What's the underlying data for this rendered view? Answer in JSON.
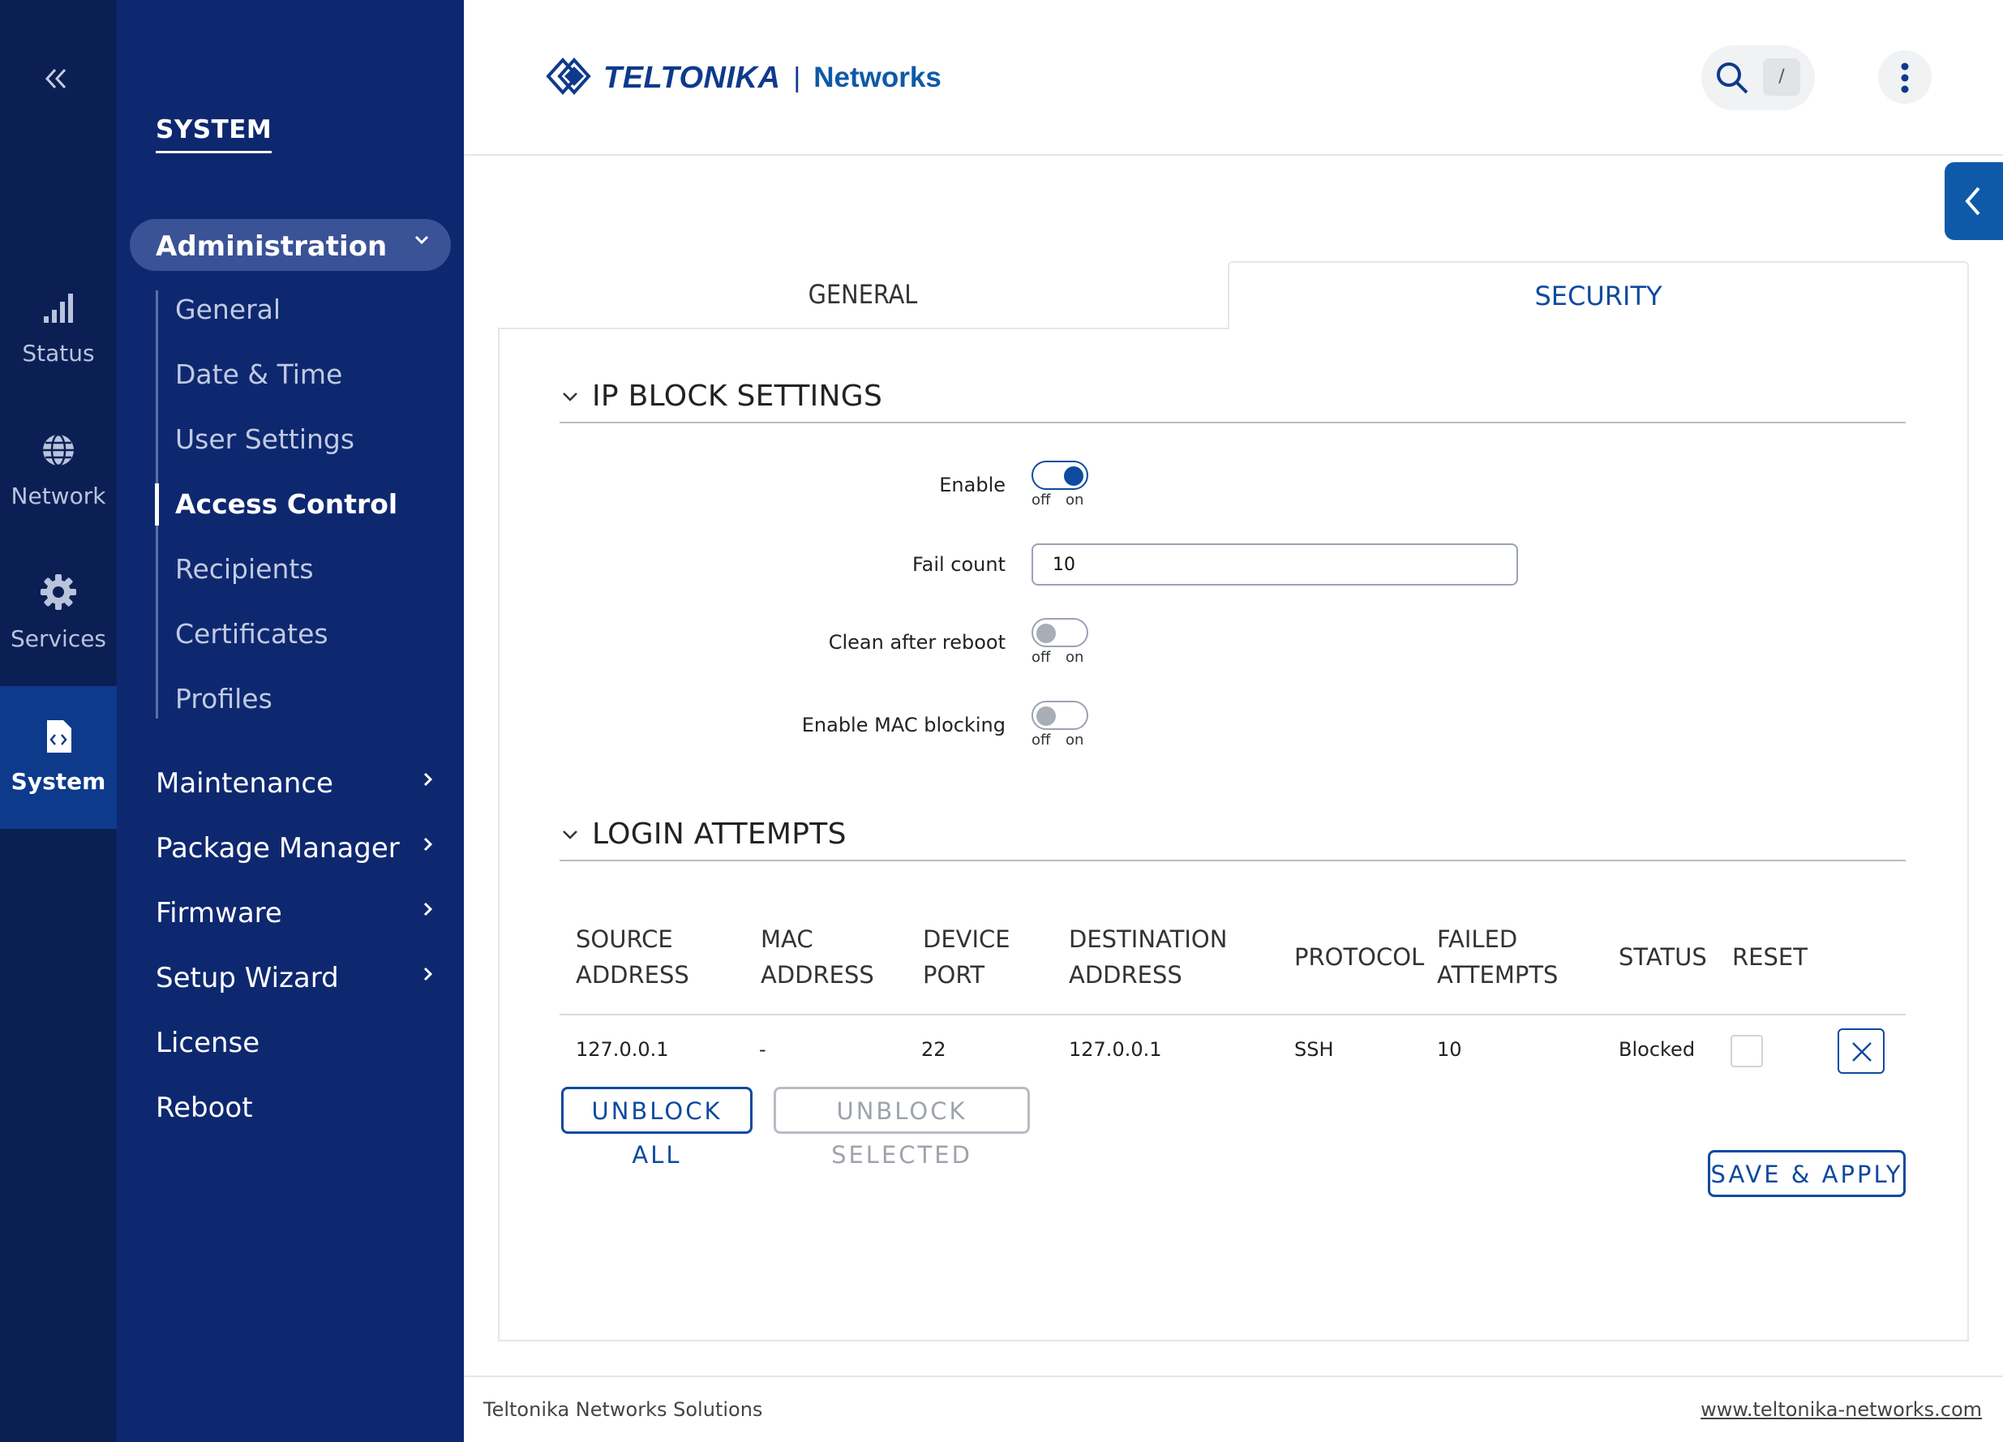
{
  "rail": {
    "collapse_icon": "double-chevron-left-icon",
    "items": [
      {
        "label": "Status",
        "icon": "signal-bars-icon"
      },
      {
        "label": "Network",
        "icon": "globe-icon"
      },
      {
        "label": "Services",
        "icon": "gear-icon"
      },
      {
        "label": "System",
        "icon": "code-file-icon",
        "active": true
      }
    ]
  },
  "sidebar": {
    "title": "SYSTEM",
    "admin": {
      "label": "Administration"
    },
    "sub_items": [
      {
        "label": "General"
      },
      {
        "label": "Date & Time"
      },
      {
        "label": "User Settings"
      },
      {
        "label": "Access Control",
        "active": true
      },
      {
        "label": "Recipients"
      },
      {
        "label": "Certificates"
      },
      {
        "label": "Profiles"
      }
    ],
    "menu_items": [
      {
        "label": "Maintenance",
        "has_children": true
      },
      {
        "label": "Package Manager",
        "has_children": true
      },
      {
        "label": "Firmware",
        "has_children": true
      },
      {
        "label": "Setup Wizard",
        "has_children": true
      },
      {
        "label": "License"
      },
      {
        "label": "Reboot"
      }
    ]
  },
  "header": {
    "brand": "TELTONIKA",
    "separator": "|",
    "brand_sub": "Networks",
    "search_shortcut": "/"
  },
  "tabs": {
    "general": "GENERAL",
    "security": "SECURITY",
    "active": "SECURITY"
  },
  "ip_block": {
    "title": "IP BLOCK SETTINGS",
    "enable": {
      "label": "Enable",
      "state": "on",
      "off": "off",
      "on": "on"
    },
    "fail_count": {
      "label": "Fail count",
      "value": "10"
    },
    "clean_after_reboot": {
      "label": "Clean after reboot",
      "state": "off",
      "off": "off",
      "on": "on"
    },
    "mac_blocking": {
      "label": "Enable MAC blocking",
      "state": "off",
      "off": "off",
      "on": "on"
    }
  },
  "login_attempts": {
    "title": "LOGIN ATTEMPTS",
    "columns": [
      {
        "l1": "SOURCE",
        "l2": "ADDRESS"
      },
      {
        "l1": "MAC",
        "l2": "ADDRESS"
      },
      {
        "l1": "DEVICE",
        "l2": "PORT"
      },
      {
        "l1": "DESTINATION",
        "l2": "ADDRESS"
      },
      {
        "l1": "PROTOCOL",
        "l2": ""
      },
      {
        "l1": "FAILED",
        "l2": "ATTEMPTS"
      },
      {
        "l1": "STATUS",
        "l2": ""
      },
      {
        "l1": "RESET",
        "l2": ""
      }
    ],
    "rows": [
      {
        "source": "127.0.0.1",
        "mac": "-",
        "port": "22",
        "destination": "127.0.0.1",
        "protocol": "SSH",
        "failed": "10",
        "status": "Blocked"
      }
    ],
    "unblock_all": "UNBLOCK ALL",
    "unblock_selected": "UNBLOCK SELECTED"
  },
  "save_apply": "SAVE & APPLY",
  "footer": {
    "left": "Teltonika Networks Solutions",
    "right": "www.teltonika-networks.com"
  },
  "colors": {
    "rail_bg": "#0b1f55",
    "sidebar_bg": "#0e2870",
    "accent": "#0e4aa0",
    "active_rail": "#0e3a8c"
  }
}
